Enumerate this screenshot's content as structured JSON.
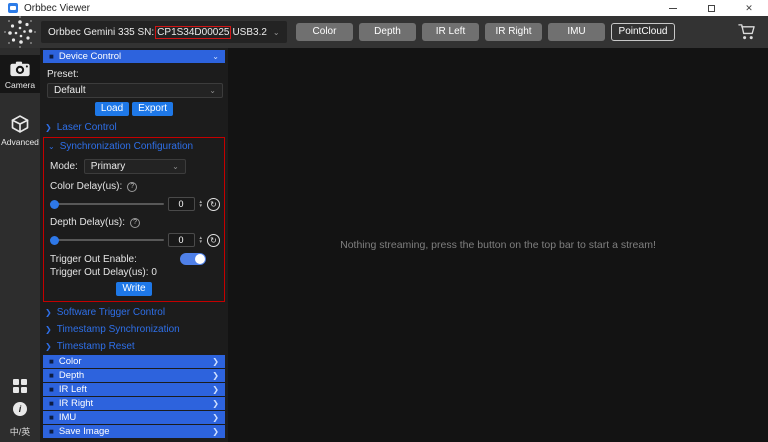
{
  "window": {
    "title": "Orbbec Viewer"
  },
  "icons": {
    "close": "✕",
    "chevron_down": "⌄",
    "chevron_right": "❯",
    "bullet": "■",
    "help": "?",
    "reset": "↻",
    "spin_up": "▲",
    "spin_down": "▼",
    "info": "i"
  },
  "toolbar": {
    "device": {
      "prefix": "Orbbec Gemini 335 SN:",
      "serial": "CP1S34D00025",
      "suffix": "USB3.2"
    },
    "buttons": [
      {
        "label": "Color",
        "active": false
      },
      {
        "label": "Depth",
        "active": false
      },
      {
        "label": "IR Left",
        "active": false
      },
      {
        "label": "IR Right",
        "active": false
      },
      {
        "label": "IMU",
        "active": false
      },
      {
        "label": "PointCloud",
        "active": true
      }
    ]
  },
  "sidebar": {
    "camera_label": "Camera",
    "advanced_label": "Advanced",
    "language_toggle": "中/英"
  },
  "panel": {
    "device_control_title": "Device Control",
    "preset_label": "Preset:",
    "preset_value": "Default",
    "load_button": "Load",
    "export_button": "Export",
    "laser_link": "Laser Control",
    "sync": {
      "title": "Synchronization Configuration",
      "mode_label": "Mode:",
      "mode_value": "Primary",
      "color_delay_label": "Color Delay(us):",
      "color_delay_value": "0",
      "depth_delay_label": "Depth Delay(us):",
      "depth_delay_value": "0",
      "trigger_enable_label": "Trigger Out Enable:",
      "trigger_delay_text": "Trigger Out Delay(us): 0",
      "write_button": "Write"
    },
    "software_trigger_link": "Software Trigger Control",
    "timestamp_sync_link": "Timestamp Synchronization",
    "timestamp_reset_link": "Timestamp Reset",
    "sections": [
      "Color",
      "Depth",
      "IR Left",
      "IR Right",
      "IMU",
      "Save Image"
    ]
  },
  "main": {
    "empty_message": "Nothing streaming, press the button on the top bar to start a stream!"
  },
  "colors": {
    "accent_blue": "#1e78e8",
    "header_blue": "#2d63dd",
    "link_blue": "#2e6fe8",
    "highlight_red": "#c40000"
  }
}
